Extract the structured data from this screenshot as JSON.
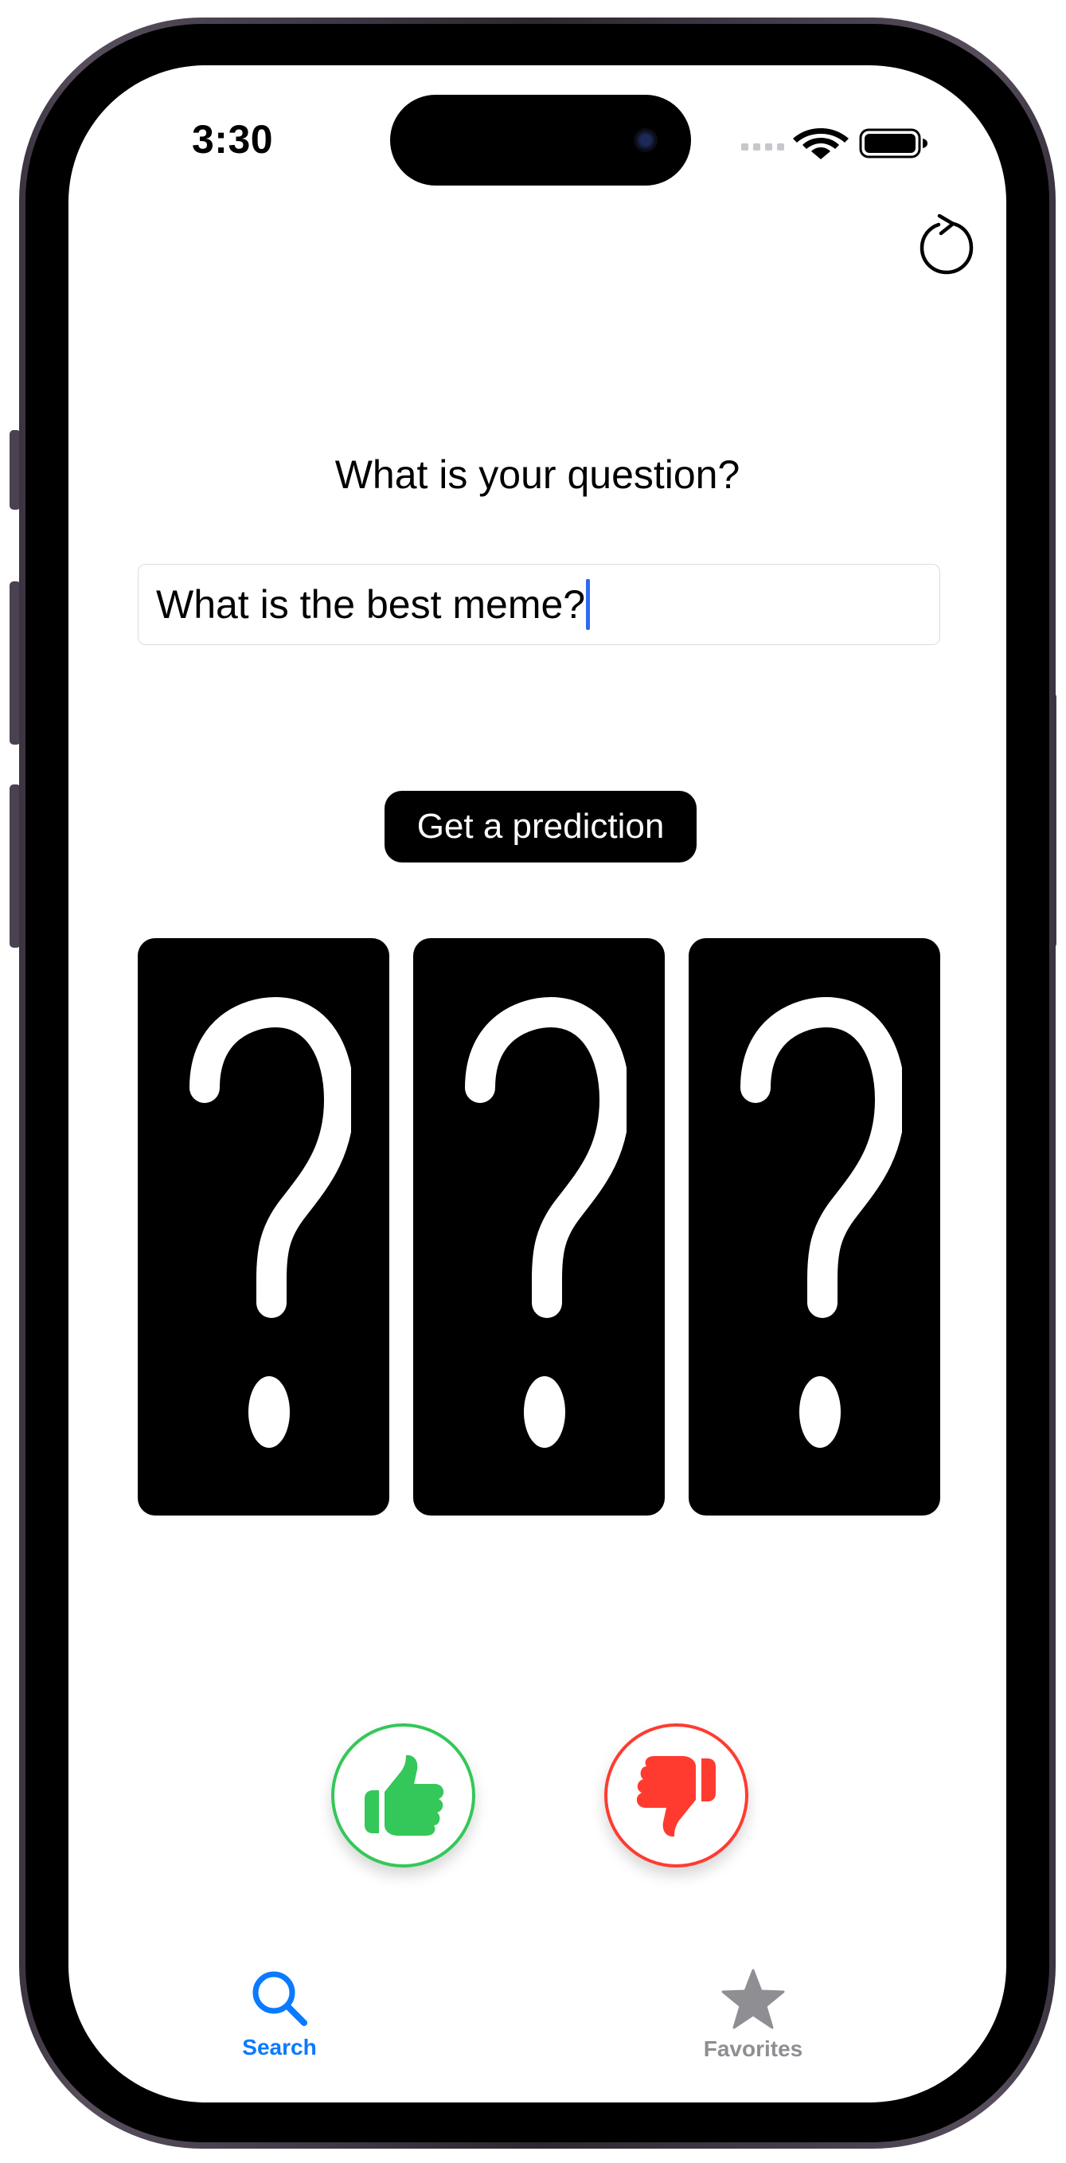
{
  "status_bar": {
    "time": "3:30"
  },
  "toolbar": {
    "refresh_icon": "arrow-clockwise-icon"
  },
  "question": {
    "label": "What is your question?",
    "input_value": "What is the best meme?"
  },
  "predict_button": {
    "label": "Get a prediction"
  },
  "cards": [
    {
      "symbol": "?"
    },
    {
      "symbol": "?"
    },
    {
      "symbol": "?"
    }
  ],
  "feedback": {
    "thumbs_up_icon": "hand-thumbsup-fill-icon",
    "thumbs_down_icon": "hand-thumbsdown-fill-icon",
    "up_color": "#34c759",
    "down_color": "#ff3b30"
  },
  "tab_bar": {
    "items": [
      {
        "label": "Search",
        "icon": "magnifyingglass-icon",
        "selected": true
      },
      {
        "label": "Favorites",
        "icon": "star-fill-icon",
        "selected": false
      }
    ],
    "active_color": "#0a7aff",
    "inactive_color": "#8e8e93"
  }
}
